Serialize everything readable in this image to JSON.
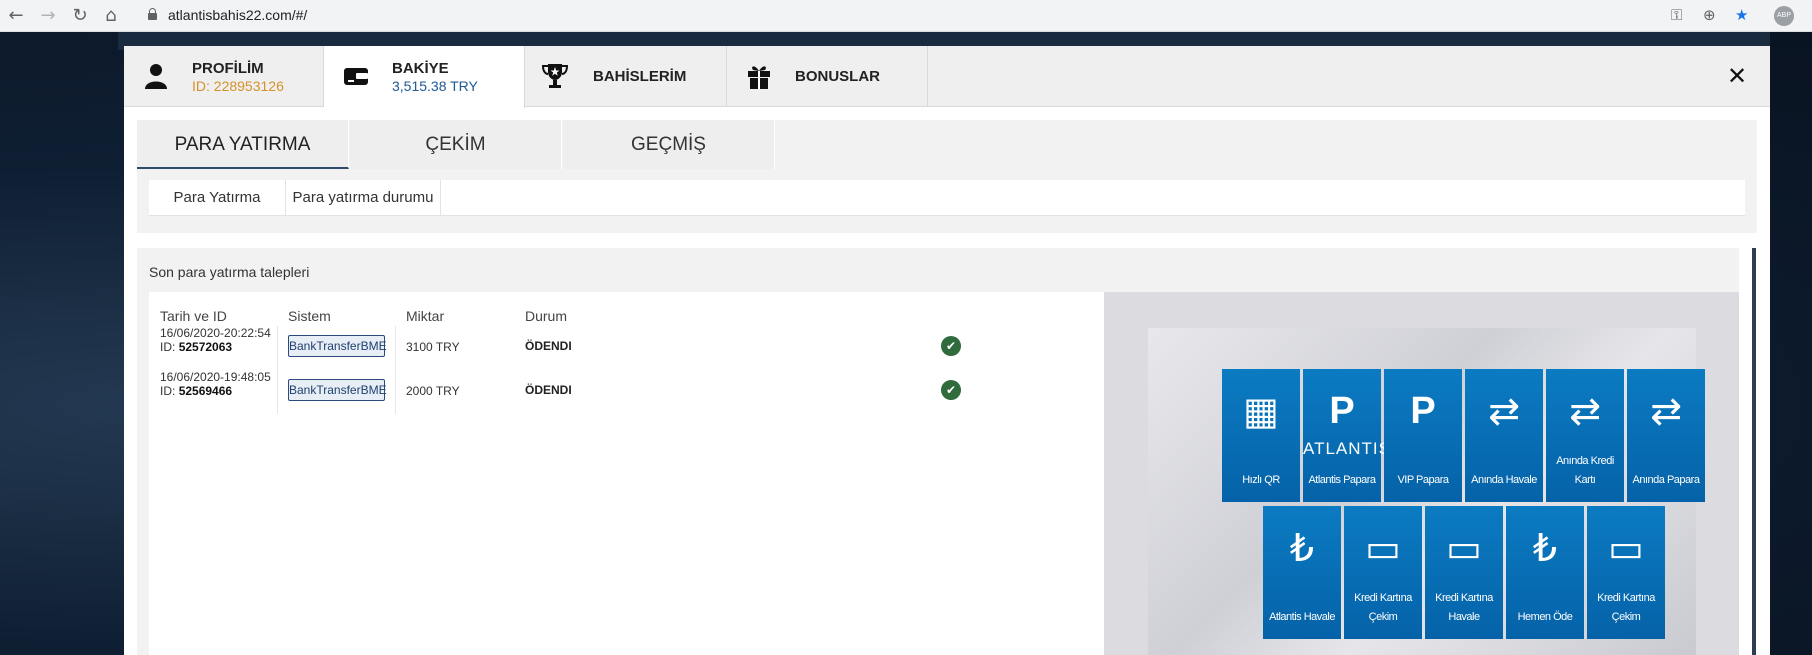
{
  "browser": {
    "url": "atlantisbahis22.com/#/",
    "avatar_label": "ABP"
  },
  "topnav": {
    "profile_label": "PROFİLİM",
    "profile_id": "ID: 228953126",
    "balance_label": "BAKİYE",
    "balance_value": "3,515.38 TRY",
    "bets_label": "BAHİSLERİM",
    "bonus_label": "BONUSLAR"
  },
  "tabs": [
    {
      "label": "PARA YATIRMA"
    },
    {
      "label": "ÇEKİM"
    },
    {
      "label": "GEÇMİŞ"
    }
  ],
  "subtabs": [
    {
      "label": "Para Yatırma"
    },
    {
      "label": "Para yatırma durumu"
    }
  ],
  "requests": {
    "title": "Son para yatırma talepleri",
    "headers": {
      "date": "Tarih ve ID",
      "system": "Sistem",
      "amount": "Miktar",
      "status": "Durum"
    },
    "rows": [
      {
        "date": "16/06/2020-20:22:54",
        "id_label": "ID:",
        "id": "52572063",
        "system": "BankTransferBME",
        "amount": "3100 TRY",
        "status": "ÖDENDI"
      },
      {
        "date": "16/06/2020-19:48:05",
        "id_label": "ID:",
        "id": "52569466",
        "system": "BankTransferBME",
        "amount": "2000 TRY",
        "status": "ÖDENDI"
      }
    ]
  },
  "payment_methods": {
    "row1": [
      {
        "label": "Hızlı QR"
      },
      {
        "label": "Atlantis Papara",
        "word": "ATLANTIS"
      },
      {
        "label": "VIP Papara"
      },
      {
        "label": "Anında Havale"
      },
      {
        "label": "Anında Kredi Kartı"
      },
      {
        "label": "Anında Papara"
      }
    ],
    "row2": [
      {
        "label": "Atlantis Havale"
      },
      {
        "label": "Kredi Kartına Çekim"
      },
      {
        "label": "Kredi Kartına Havale"
      },
      {
        "label": "Hemen Öde"
      },
      {
        "label": "Kredi Kartına Çekim"
      }
    ]
  },
  "colors": {
    "accent_orange": "#d4922b",
    "accent_blue": "#1e5a96",
    "tile_blue": "#0b6fb8",
    "paid_green": "#2f6b3c"
  }
}
